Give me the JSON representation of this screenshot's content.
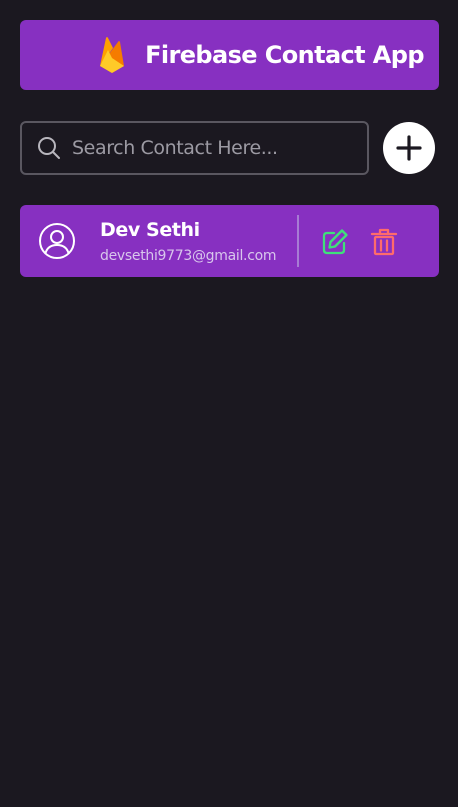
{
  "header": {
    "title": "Firebase Contact App",
    "logo_icon": "firebase-flame-icon"
  },
  "search": {
    "placeholder": "Search Contact Here...",
    "value": "",
    "icon": "search-icon"
  },
  "add_button": {
    "icon": "plus-icon"
  },
  "contacts": [
    {
      "name": "Dev Sethi",
      "email": "devsethi9773@gmail.com",
      "avatar_icon": "user-circle-icon",
      "edit_icon": "edit-icon",
      "delete_icon": "trash-icon"
    }
  ],
  "colors": {
    "background": "#1b1820",
    "accent": "#8730c1",
    "edit": "#3fe07a",
    "delete": "#ff6b6b"
  }
}
